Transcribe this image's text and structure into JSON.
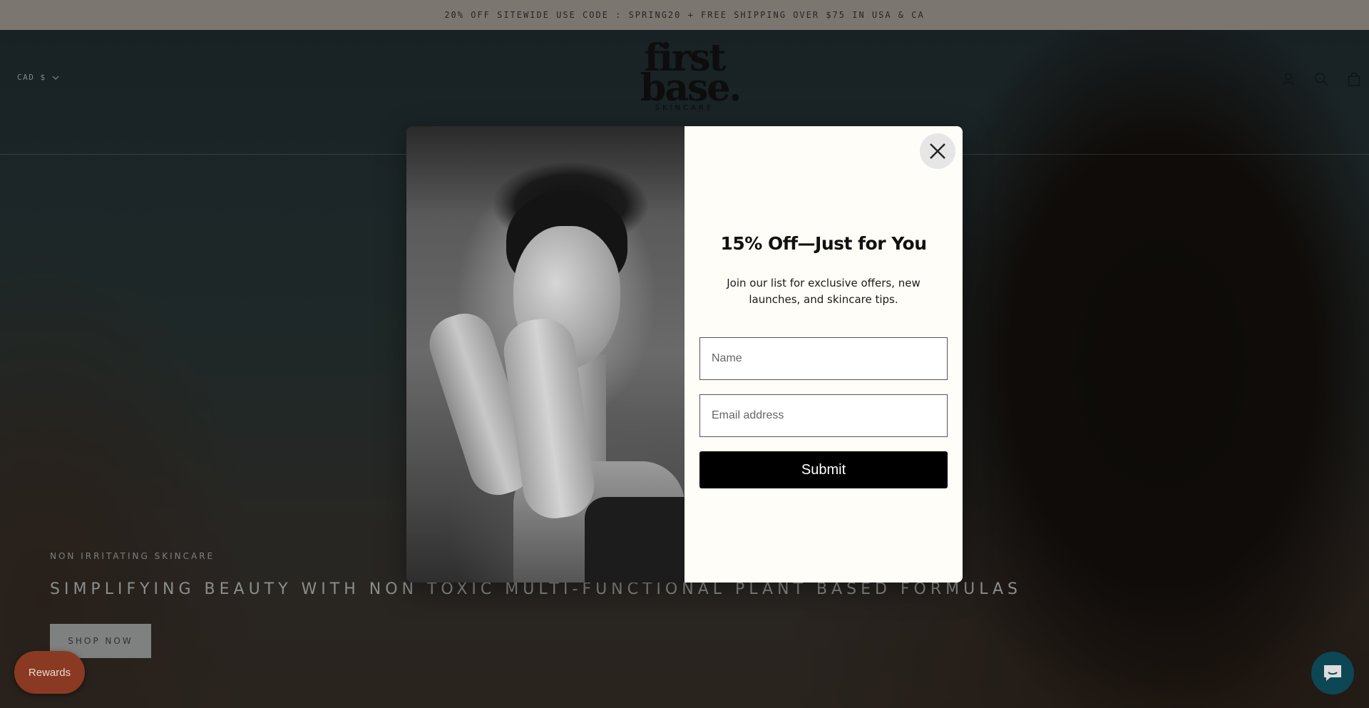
{
  "announcement": {
    "text": "20% OFF SITEWIDE USE CODE : SPRING20 + FREE SHIPPING OVER $75 IN USA & CA"
  },
  "header": {
    "currency": "CAD $",
    "logo": {
      "line1": "first",
      "line2": "base.",
      "line3": "SKINCARE"
    }
  },
  "hero": {
    "subtitle": "NON IRRITATING SKINCARE",
    "title": "SIMPLIFYING BEAUTY WITH NON TOXIC MULTI-FUNCTIONAL PLANT BASED FORMULAS",
    "cta_label": "SHOP NOW"
  },
  "popup": {
    "title": "15% Off—Just for You",
    "text": "Join our list for exclusive offers, new launches, and skincare tips.",
    "name_placeholder": "Name",
    "email_placeholder": "Email address",
    "submit_label": "Submit"
  },
  "rewards": {
    "label": "Rewards"
  },
  "icons": {
    "account": "account-icon",
    "search": "search-icon",
    "cart": "cart-icon",
    "close": "close-icon",
    "chat": "chat-icon",
    "chevron": "chevron-down-icon"
  },
  "colors": {
    "rewards_bg": "#8a3a22",
    "popup_bg": "#fffdf7",
    "submit_bg": "#000000",
    "announcement_bg": "#7b7770",
    "chat_bg": "#0a4f60"
  }
}
